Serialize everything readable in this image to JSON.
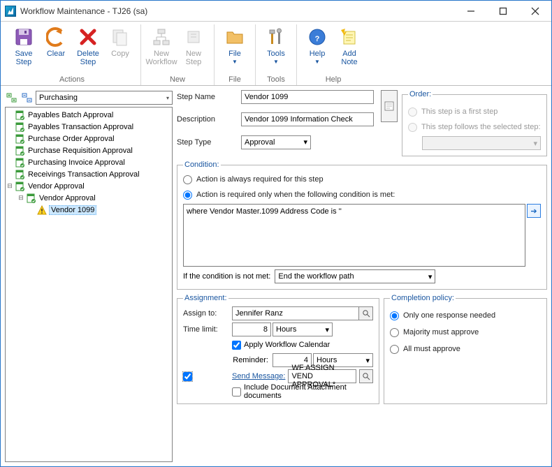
{
  "window": {
    "title": "Workflow Maintenance  -  TJ26 (sa)"
  },
  "ribbon": {
    "groups": [
      {
        "label": "Actions",
        "buttons": [
          {
            "label": "Save\nStep",
            "id": "save"
          },
          {
            "label": "Clear",
            "id": "clear"
          },
          {
            "label": "Delete\nStep",
            "id": "delete"
          },
          {
            "label": "Copy",
            "id": "copy",
            "disabled": true
          }
        ]
      },
      {
        "label": "New",
        "buttons": [
          {
            "label": "New\nWorkflow",
            "id": "newwf",
            "disabled": true
          },
          {
            "label": "New\nStep",
            "id": "newstep",
            "disabled": true
          }
        ]
      },
      {
        "label": "File",
        "buttons": [
          {
            "label": "File",
            "id": "file",
            "dd": true
          }
        ]
      },
      {
        "label": "Tools",
        "buttons": [
          {
            "label": "Tools",
            "id": "tools",
            "dd": true
          }
        ]
      },
      {
        "label": "Help",
        "buttons": [
          {
            "label": "Help",
            "id": "help",
            "dd": true
          },
          {
            "label": "Add\nNote",
            "id": "addnote"
          }
        ]
      }
    ]
  },
  "left": {
    "dropdown": "Purchasing",
    "tree": [
      {
        "d": 0,
        "exp": "",
        "icon": "doc",
        "label": "Payables Batch Approval"
      },
      {
        "d": 0,
        "exp": "",
        "icon": "doc",
        "label": "Payables Transaction Approval"
      },
      {
        "d": 0,
        "exp": "",
        "icon": "doc",
        "label": "Purchase Order Approval"
      },
      {
        "d": 0,
        "exp": "",
        "icon": "doc",
        "label": "Purchase Requisition Approval"
      },
      {
        "d": 0,
        "exp": "",
        "icon": "doc",
        "label": "Purchasing Invoice Approval"
      },
      {
        "d": 0,
        "exp": "",
        "icon": "doc",
        "label": "Receivings Transaction Approval"
      },
      {
        "d": 0,
        "exp": "⊟",
        "icon": "doc",
        "label": "Vendor Approval"
      },
      {
        "d": 1,
        "exp": "⊟",
        "icon": "doc",
        "label": "Vendor Approval"
      },
      {
        "d": 2,
        "exp": "",
        "icon": "warn",
        "label": "Vendor 1099",
        "sel": true
      }
    ]
  },
  "step": {
    "labels": {
      "name": "Step Name",
      "desc": "Description",
      "type": "Step Type"
    },
    "name": "Vendor 1099",
    "desc": "Vendor 1099 Information Check",
    "type": "Approval"
  },
  "order": {
    "legend": "Order:",
    "opt1": "This step is a first step",
    "opt2": "This step follows the selected step:"
  },
  "cond": {
    "legend": "Condition:",
    "opt1": "Action is always required for this step",
    "opt2": "Action is required only when the following condition is met:",
    "text": "where Vendor Master.1099 Address Code is ''",
    "notmet_label": "If the condition is not met:",
    "notmet_value": "End the workflow path"
  },
  "assign": {
    "legend": "Assignment:",
    "to_label": "Assign to:",
    "to_value": "Jennifer Ranz",
    "time_label": "Time limit:",
    "time_value": "8",
    "time_unit": "Hours",
    "apply_cal": "Apply Workflow Calendar",
    "reminder_label": "Reminder:",
    "reminder_value": "4",
    "reminder_unit": "Hours",
    "send_msg": "Send Message:",
    "msg_value": "WF ASSIGN VEND APPROVAL*",
    "include_docs": "Include Document Attachment documents"
  },
  "policy": {
    "legend": "Completion policy:",
    "opt1": "Only one response needed",
    "opt2": "Majority must approve",
    "opt3": "All must approve"
  }
}
